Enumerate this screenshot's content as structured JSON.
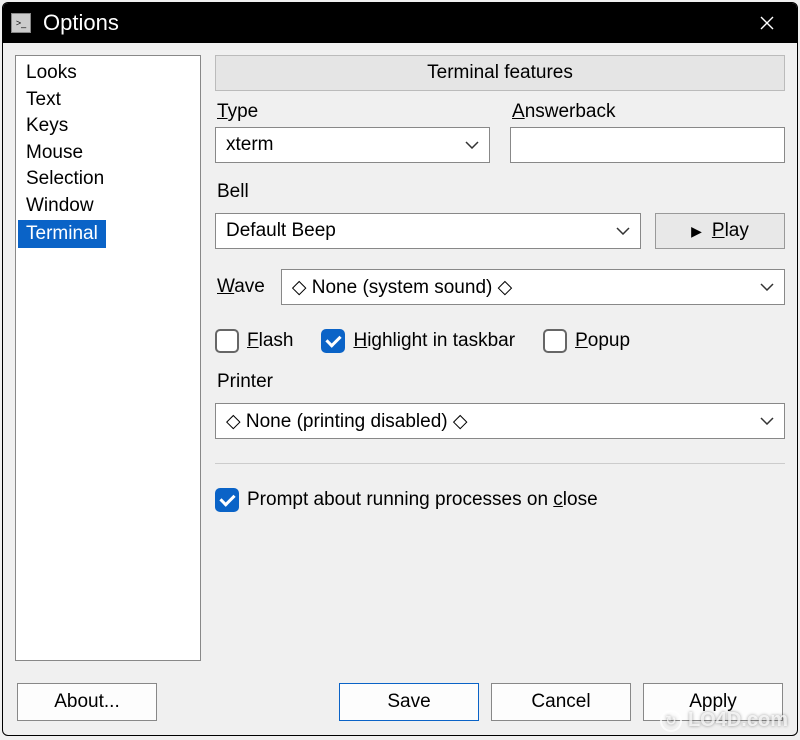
{
  "window": {
    "title": "Options"
  },
  "sidebar": {
    "items": [
      {
        "label": "Looks",
        "selected": false
      },
      {
        "label": "Text",
        "selected": false
      },
      {
        "label": "Keys",
        "selected": false
      },
      {
        "label": "Mouse",
        "selected": false
      },
      {
        "label": "Selection",
        "selected": false
      },
      {
        "label": "Window",
        "selected": false
      },
      {
        "label": "Terminal",
        "selected": true
      }
    ]
  },
  "main": {
    "section_title": "Terminal features",
    "type": {
      "label": "Type",
      "value": "xterm"
    },
    "answerback": {
      "label": "Answerback",
      "value": ""
    },
    "bell": {
      "label": "Bell",
      "sound": "Default Beep",
      "play_label": "Play",
      "wave_label": "Wave",
      "wave_value": "◇ None (system sound) ◇",
      "flash": {
        "label": "Flash",
        "checked": false
      },
      "highlight": {
        "label": "Highlight in taskbar",
        "checked": true
      },
      "popup": {
        "label": "Popup",
        "checked": false
      }
    },
    "printer": {
      "label": "Printer",
      "value": "◇ None (printing disabled) ◇"
    },
    "prompt": {
      "label": "Prompt about running processes on close",
      "checked": true
    }
  },
  "footer": {
    "about": "About...",
    "save": "Save",
    "cancel": "Cancel",
    "apply": "Apply"
  },
  "watermark": "LO4D.com"
}
